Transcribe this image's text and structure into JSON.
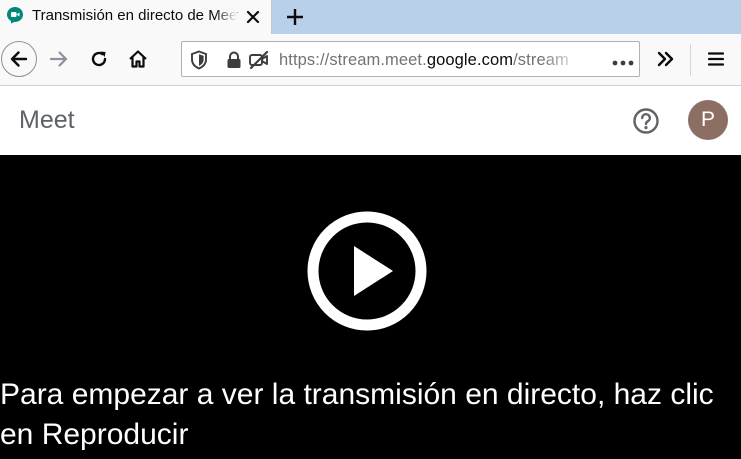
{
  "browser": {
    "tab": {
      "title": "Transmisión en directo de Meet",
      "favicon": "meet-icon"
    },
    "url": {
      "scheme": "https://",
      "subdomain": "stream.meet.",
      "host": "google.com",
      "path": "/stream"
    },
    "icons": {
      "back": "arrow-left-icon",
      "forward": "arrow-right-icon",
      "reload": "reload-icon",
      "home": "home-icon",
      "shield": "shield-icon",
      "lock": "lock-icon",
      "camera_blocked": "camera-blocked-icon",
      "more": "more-dots-icon",
      "overflow": "chevron-double-right-icon",
      "menu": "hamburger-menu-icon",
      "close_tab": "close-icon",
      "new_tab": "plus-icon"
    }
  },
  "meet": {
    "title": "Meet",
    "avatar_initial": "P",
    "help_icon": "help-icon",
    "colors": {
      "avatar": "#8d6e63",
      "title": "#5f6368"
    }
  },
  "player": {
    "play_icon": "play-icon",
    "message": "Para empezar a ver la transmisión en directo, haz clic en Reproducir"
  }
}
